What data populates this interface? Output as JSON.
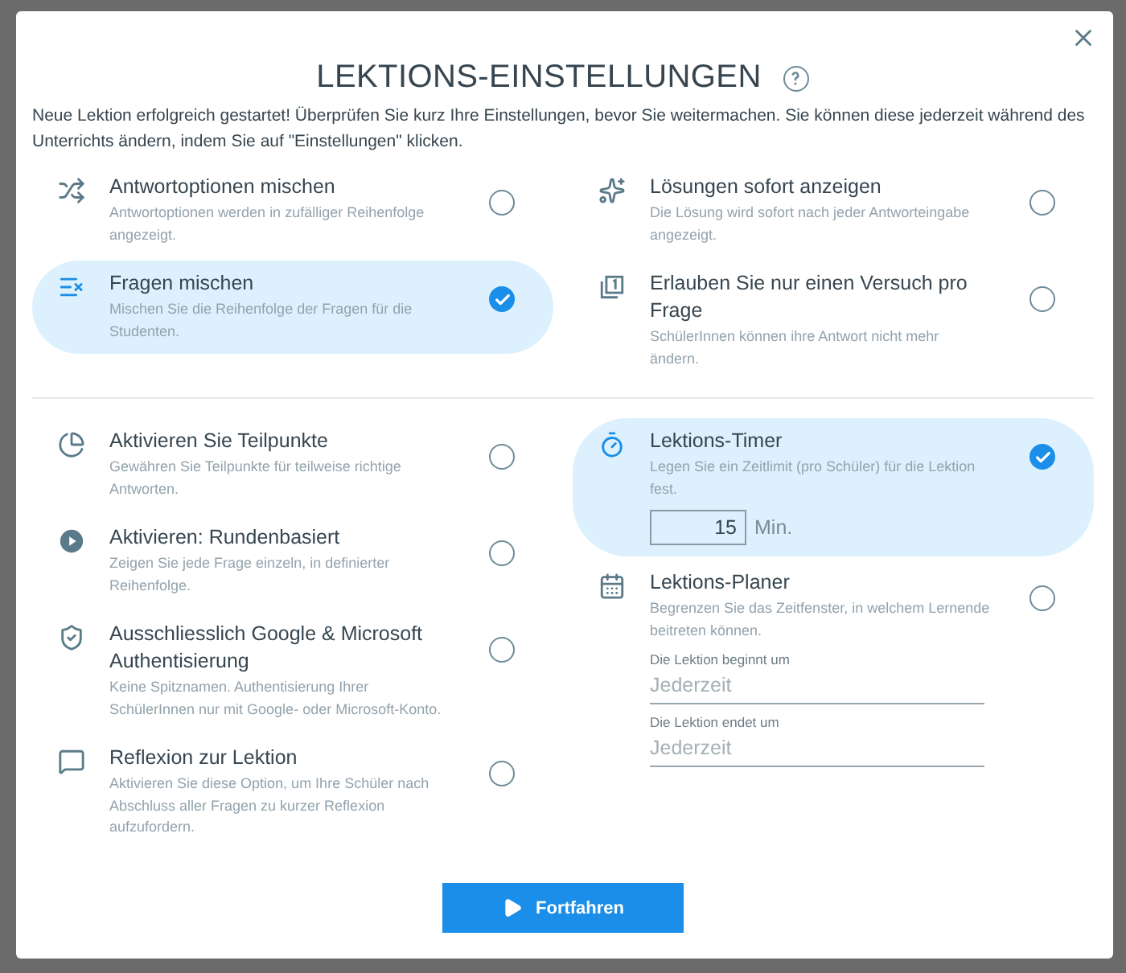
{
  "dialog": {
    "title": "LEKTIONS-EINSTELLUNGEN",
    "intro": "Neue Lektion erfolgreich gestartet! Überprüfen Sie kurz Ihre Einstellungen, bevor Sie weitermachen. Sie können diese jederzeit während des Unterrichts ändern, indem Sie auf \"Einstellungen\" klicken.",
    "sections": [
      {
        "left": [
          {
            "title": "Antwortoptionen mischen",
            "description": "Antwortoptionen werden in zufälliger Reihenfolge angezeigt.",
            "selected": false
          },
          {
            "title": "Fragen mischen",
            "description": "Mischen Sie die Reihenfolge der Fragen für die Studenten.",
            "selected": true
          }
        ],
        "right": [
          {
            "title": "Lösungen sofort anzeigen",
            "description": "Die Lösung wird sofort nach jeder Antworteingabe angezeigt.",
            "selected": false
          },
          {
            "title": "Erlauben Sie nur einen Versuch pro Frage",
            "description": "SchülerInnen können ihre Antwort nicht mehr ändern.",
            "selected": false
          }
        ]
      },
      {
        "left": [
          {
            "title": "Aktivieren Sie Teilpunkte",
            "description": "Gewähren Sie Teilpunkte für teilweise richtige Antworten.",
            "selected": false
          },
          {
            "title": "Aktivieren: Rundenbasiert",
            "description": "Zeigen Sie jede Frage einzeln, in definierter Reihenfolge.",
            "selected": false
          },
          {
            "title": "Ausschliesslich Google & Microsoft Authentisierung",
            "description": "Keine Spitznamen. Authentisierung Ihrer SchülerInnen nur mit Google- oder Microsoft-Konto.",
            "selected": false
          },
          {
            "title": "Reflexion zur Lektion",
            "description": "Aktivieren Sie diese Option, um Ihre Schüler nach Abschluss aller Fragen zu kurzer Reflexion aufzufordern.",
            "selected": false
          }
        ],
        "right": [
          {
            "kind": "timer",
            "title": "Lektions-Timer",
            "description": "Legen Sie ein Zeitlimit (pro Schüler) für die Lektion fest.",
            "selected": true,
            "value": "15",
            "unit": "Min."
          },
          {
            "kind": "schedule",
            "title": "Lektions-Planer",
            "description": "Begrenzen Sie das Zeitfenster, in welchem Lernende beitreten können.",
            "selected": false,
            "fields": [
              {
                "label": "Die Lektion beginnt um",
                "placeholder": "Jederzeit"
              },
              {
                "label": "Die Lektion endet um",
                "placeholder": "Jederzeit"
              }
            ]
          }
        ]
      }
    ],
    "button": "Fortfahren"
  }
}
